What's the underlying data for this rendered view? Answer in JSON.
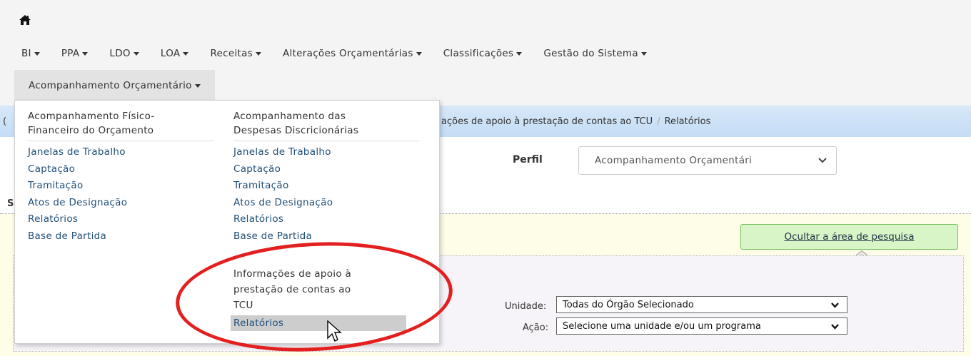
{
  "nav": {
    "items": [
      "BI",
      "PPA",
      "LDO",
      "LOA",
      "Receitas",
      "Alterações Orçamentárias",
      "Classificações",
      "Gestão do Sistema"
    ],
    "row2": "Acompanhamento Orçamentário"
  },
  "breadcrumb": {
    "left": "(",
    "current": "ações de apoio à prestação de contas ao TCU",
    "last": "Relatórios"
  },
  "perfil": {
    "label": "Perfil",
    "value": "Acompanhamento Orçamentári"
  },
  "side_letter": "S(",
  "search": {
    "toggle_label": "Ocultar a área de pesquisa",
    "unidade_label": "Unidade:",
    "unidade_value": "Todas do Órgão Selecionado",
    "acao_label": "Ação:",
    "acao_value": "Selecione uma unidade e/ou um programa"
  },
  "menu": {
    "col1": {
      "heading": [
        "Acompanhamento Físico-",
        "Financeiro do Orçamento"
      ],
      "links": [
        "Janelas de Trabalho",
        "Captação",
        "Tramitação",
        "Atos de Designação",
        "Relatórios",
        "Base de Partida"
      ]
    },
    "col2": {
      "heading": [
        "Acompanhamento das",
        "Despesas Discricionárias"
      ],
      "links": [
        "Janelas de Trabalho",
        "Captação",
        "Tramitação",
        "Atos de Designação",
        "Relatórios",
        "Base de Partida"
      ]
    },
    "section2": {
      "heading": [
        "Informações de apoio à",
        "prestação de contas ao",
        "TCU"
      ],
      "highlighted": "Relatórios"
    }
  },
  "colors": {
    "link": "#1f4e79",
    "annotation": "#e32020",
    "toggle_bg": "#d8f5c8"
  }
}
